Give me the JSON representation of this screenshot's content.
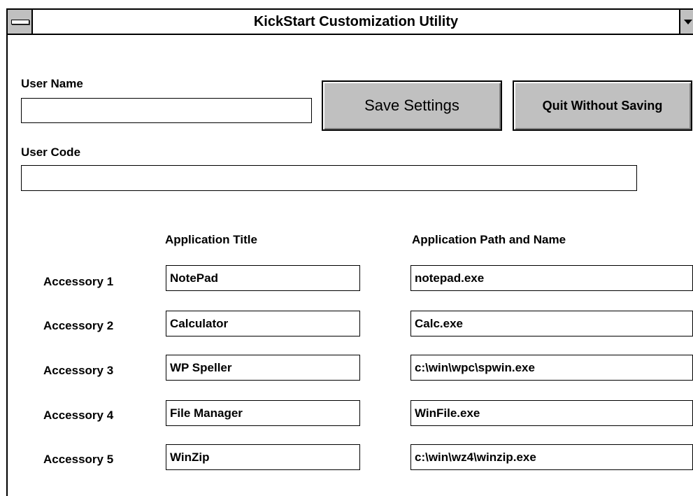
{
  "window": {
    "title": "KickStart Customization Utility"
  },
  "user_name": {
    "label": "User Name",
    "value": ""
  },
  "user_code": {
    "label": "User Code",
    "value": ""
  },
  "buttons": {
    "save": "Save Settings",
    "quit": "Quit Without Saving"
  },
  "columns": {
    "title": "Application Title",
    "path": "Application Path and Name"
  },
  "accessories": [
    {
      "label": "Accessory 1",
      "title": "NotePad",
      "path": "notepad.exe"
    },
    {
      "label": "Accessory 2",
      "title": "Calculator",
      "path": "Calc.exe"
    },
    {
      "label": "Accessory 3",
      "title": "WP Speller",
      "path": "c:\\win\\wpc\\spwin.exe"
    },
    {
      "label": "Accessory 4",
      "title": "File Manager",
      "path": "WinFile.exe"
    },
    {
      "label": "Accessory 5",
      "title": "WinZip",
      "path": "c:\\win\\wz4\\winzip.exe"
    }
  ]
}
